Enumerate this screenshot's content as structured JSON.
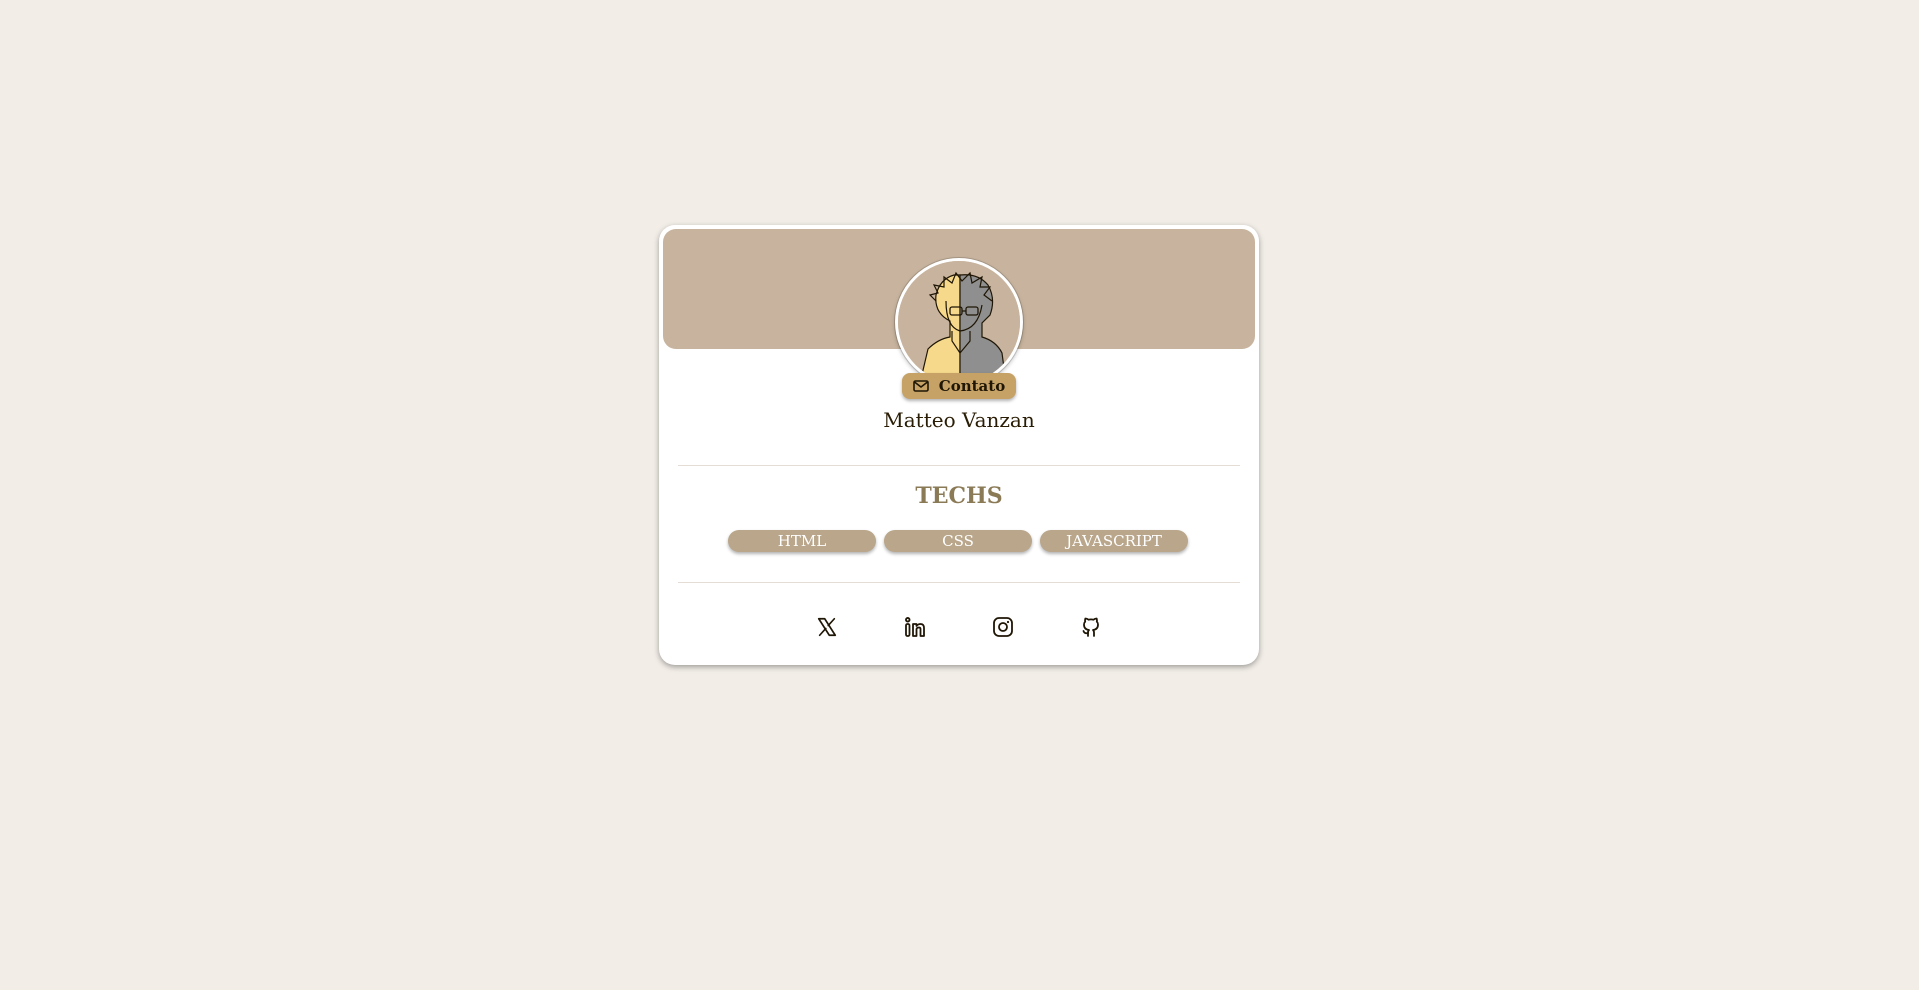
{
  "profile": {
    "name": "Matteo Vanzan",
    "contact_label": "Contato"
  },
  "techs": {
    "title": "TECHS",
    "items": [
      "HTML",
      "CSS",
      "JAVASCRIPT"
    ]
  },
  "socials": [
    "x-icon",
    "linkedin-icon",
    "instagram-icon",
    "github-icon"
  ],
  "colors": {
    "background": "#f2ede7",
    "banner": "#c8b49e",
    "contact_button": "#c6a266",
    "tech_tag": "#b9a68b",
    "techs_title": "#8a7a56",
    "text_dark": "#2a1d05"
  }
}
